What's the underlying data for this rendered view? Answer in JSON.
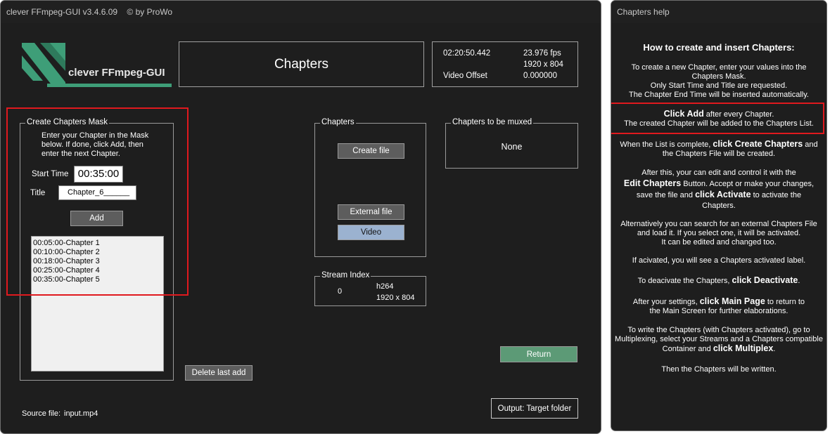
{
  "main_window": {
    "title": "clever FFmpeg-GUI v3.4.6.09    © by ProWo",
    "logo_text": "clever FFmpeg-GUI",
    "page_title": "Chapters",
    "info": {
      "duration": "02:20:50.442",
      "fps": "23.976 fps",
      "resolution": "1920 x 804",
      "offset_label": "Video Offset",
      "offset_value": "0.000000"
    },
    "create_mask": {
      "legend": "Create Chapters Mask",
      "instructions": "Enter your Chapter in the Mask below. If done, click Add, then enter the next Chapter.",
      "start_time_label": "Start Time",
      "start_time_value": "00:35:00",
      "title_label": "Title",
      "title_value": "Chapter_6______",
      "add_label": "Add",
      "chapter_list": [
        "00:05:00-Chapter 1",
        "00:10:00-Chapter 2",
        "00:18:00-Chapter 3",
        "00:25:00-Chapter 4",
        "00:35:00-Chapter 5"
      ]
    },
    "delete_last_label": "Delete last add",
    "chapters_group": {
      "legend": "Chapters",
      "create_file_label": "Create file",
      "external_file_label": "External file",
      "video_label": "Video"
    },
    "to_be_muxed": {
      "legend": "Chapters to be muxed",
      "value": "None"
    },
    "stream_index": {
      "legend": "Stream Index",
      "index": "0",
      "codec": "h264",
      "resolution": "1920 x 804"
    },
    "return_label": "Return",
    "source_file_label": "Source file:",
    "source_file_value": "input.mp4",
    "output_label": "Output: Target folder"
  },
  "help_window": {
    "title": "Chapters help",
    "heading": "How to create and insert Chapters:",
    "p1": [
      "To create a new Chapter, enter your values into the",
      "Chapters Mask.",
      "Only Start Time and Title are requested.",
      "The Chapter End Time will be inserted automatically."
    ],
    "p2": {
      "bold": "Click Add",
      "after": " after every Chapter.",
      "line2": "The created Chapter will be added to the Chapters List."
    },
    "p3": {
      "pre": "When the List is complete, ",
      "bold": "click Create Chapters",
      "post": " and",
      "line2": "the Chapters File will be created."
    },
    "p4": {
      "line1": "After this, your can edit and control it with the",
      "bold1": "Edit Chapters",
      "mid1": " Button. Accept or make your changes,",
      "pre2": "save the file and ",
      "bold2": "click Activate",
      "post2": " to activate the",
      "line4": "Chapters."
    },
    "p5": [
      "Alternatively you can search for an external Chapters File",
      "and load it. If you select one, it will be activated.",
      "It can be edited and changed too."
    ],
    "p6": "If acivated, you will see a Chapters activated label.",
    "p7": {
      "pre": "To deacivate the Chapters, ",
      "bold": "click Deactivate",
      "post": "."
    },
    "p8": {
      "pre": "After your settings, ",
      "bold": "click Main Page",
      "post": " to return to",
      "line2": "the Main Screen for further elaborations."
    },
    "p9": {
      "line1": "To write the Chapters (with Chapters activated), go to",
      "line2": "Multiplexing, select your Streams and a Chapters compatible",
      "pre3": "Container and ",
      "bold3": "click Multiplex",
      "post3": "."
    },
    "p10": "Then the Chapters will be written."
  },
  "colors": {
    "background": "#1e1e1e",
    "button": "#5d5d5d",
    "return_button": "#5c9a76",
    "video_button": "#9bb2d0",
    "highlight": "#e0191e",
    "logo": "#3e9e78"
  }
}
